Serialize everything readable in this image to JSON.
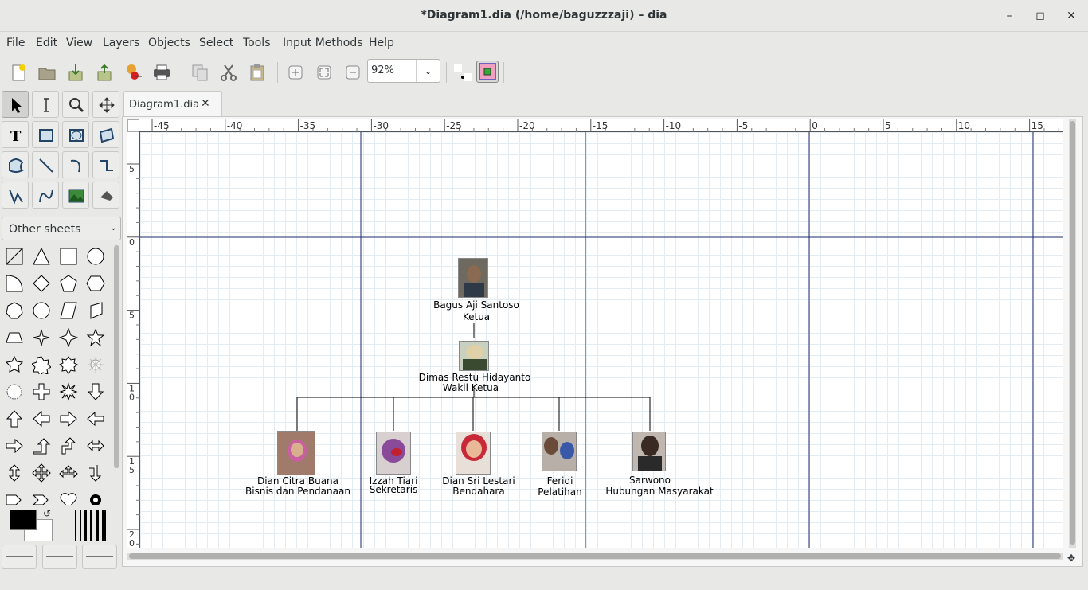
{
  "window": {
    "title": "*Diagram1.dia (/home/baguzzzaji) – dia",
    "minimize": "–",
    "maximize": "◻",
    "close": "✕"
  },
  "menu": [
    "File",
    "Edit",
    "View",
    "Layers",
    "Objects",
    "Select",
    "Tools",
    "Input Methods",
    "Help"
  ],
  "toolbar": {
    "zoom": "92%",
    "buttons": [
      "new-icon",
      "open-icon",
      "save-icon",
      "export-icon",
      "properties-icon",
      "print-icon",
      "copy-icon",
      "cut-icon",
      "paste-icon",
      "zoom-in-icon",
      "zoom-fit-icon",
      "zoom-out-icon",
      "snap-grid-icon",
      "snap-object-icon"
    ]
  },
  "toolbox": {
    "sheet": "Other sheets",
    "tools": [
      "pointer-icon",
      "text-edit-icon",
      "magnify-icon",
      "scroll-icon",
      "text-icon",
      "box-icon",
      "ellipse-icon",
      "polygon-icon",
      "beziergon-icon",
      "line-icon",
      "arc-icon",
      "zigzag-icon",
      "polyline-icon",
      "bezier-icon",
      "image-icon",
      "outline-icon"
    ]
  },
  "tab": {
    "label": "Diagram1.dia",
    "close": "✕"
  },
  "rulers": {
    "h_ticks": [
      "-45",
      "-40",
      "-35",
      "-30",
      "-25",
      "-20",
      "-15",
      "-10",
      "-5",
      "0",
      "5",
      "10",
      "15"
    ],
    "v_ticks": [
      "5",
      "0",
      "5",
      "1\n0",
      "1\n5",
      "2\n0"
    ]
  },
  "diagram": {
    "top": {
      "name": "Bagus Aji Santoso",
      "role": "Ketua"
    },
    "deputy": {
      "name": "Dimas Restu Hidayanto",
      "role": "Wakil Ketua"
    },
    "members": [
      {
        "name": "Dian Citra Buana",
        "role": "Bisnis dan Pendanaan"
      },
      {
        "name": "Izzah Tiari",
        "role": "Sekretaris"
      },
      {
        "name": "Dian Sri Lestari",
        "role": "Bendahara"
      },
      {
        "name": "Feridi",
        "role": "Pelatihan"
      },
      {
        "name": "Sarwono",
        "role": "Hubungan Masyarakat"
      }
    ]
  },
  "colors": {
    "foreground": "#000000",
    "background": "#ffffff",
    "guide": "#1b2a6b"
  }
}
